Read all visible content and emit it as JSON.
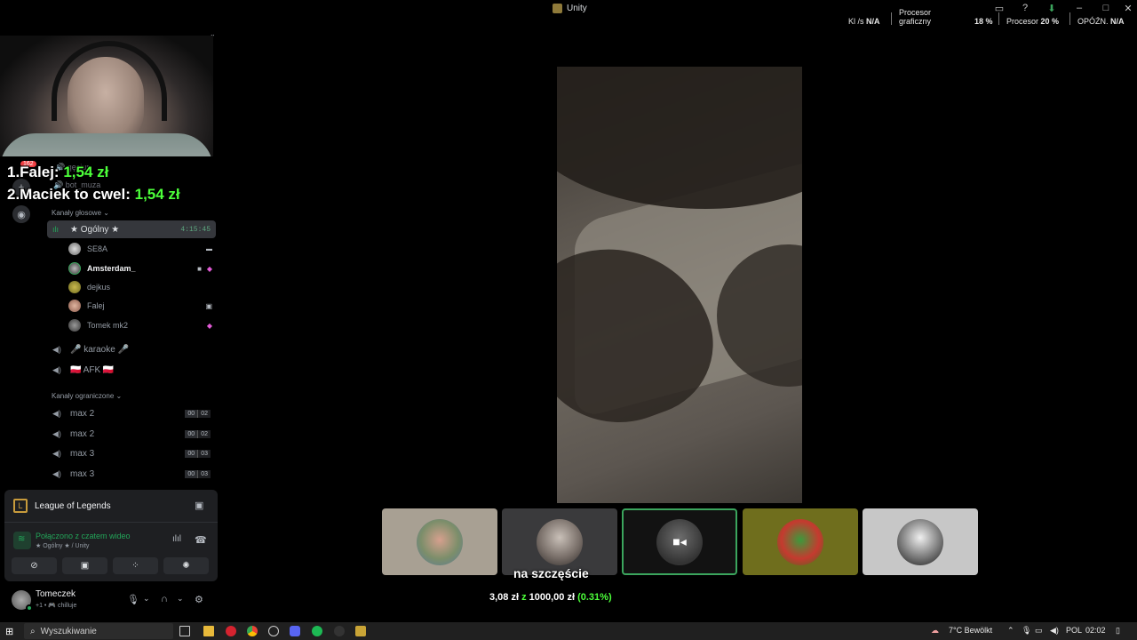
{
  "window": {
    "title": "Unity"
  },
  "perf": {
    "kb_label": "Kl /s",
    "kb_value": "N/A",
    "gpu_label_1": "Procesor",
    "gpu_label_2": "graficzny",
    "gpu_value": "18 %",
    "cpu_label": "Procesor",
    "cpu_value": "20 %",
    "delay_label": "OPÓŹN.",
    "delay_value": "N/A"
  },
  "overlay": {
    "leader_1_prefix": "1.Falej: ",
    "leader_1_amount": "1,54 zł",
    "leader_2_prefix": "2.Maciek to cwel: ",
    "leader_2_amount": "1,54 zł",
    "rail_badge": "162",
    "faded_1": "qęsiur",
    "faded_2": "bot_muza"
  },
  "sidebar": {
    "voice_category": "Kanały głosowe",
    "restricted_category": "Kanały ograniczone",
    "active_channel": {
      "name": "★ Ogólny ★",
      "timer": "4:15:45"
    },
    "members": [
      {
        "name": "SE8A",
        "bright": false
      },
      {
        "name": "Amsterdam_",
        "bright": true
      },
      {
        "name": "dejkus",
        "bright": false
      },
      {
        "name": "Falej",
        "bright": false
      },
      {
        "name": "Tomek mk2",
        "bright": false
      }
    ],
    "channels": [
      {
        "name": "🎤 karaoke 🎤"
      },
      {
        "name": "🇵🇱 AFK 🇵🇱"
      }
    ],
    "restricted": [
      {
        "name": "max 2",
        "count": "00",
        "limit": "02"
      },
      {
        "name": "max 2",
        "count": "00",
        "limit": "02"
      },
      {
        "name": "max 3",
        "count": "00",
        "limit": "03"
      },
      {
        "name": "max 3",
        "count": "00",
        "limit": "03"
      }
    ]
  },
  "panel": {
    "game": "League of Legends",
    "connection": "Połączono z czatem wideo",
    "connection_sub": "★ Ogólny ★ / Unity"
  },
  "user": {
    "name": "Tomeczek",
    "status": "+1 • 🎮 chilluje"
  },
  "stream": {
    "caption": "na szczęście",
    "donation_current": "3,08 zł",
    "donation_sep": " z ",
    "donation_goal": "1000,00 zł",
    "donation_pct": "(0.31%)"
  },
  "taskbar": {
    "search_placeholder": "Wyszukiwanie",
    "weather": "7°C  Bewölkt",
    "lang": "POL",
    "time": "02:02"
  },
  "colors": {
    "accent_green": "#4cff3a",
    "discord_green": "#23a559",
    "selected_border": "#3ba55d"
  }
}
